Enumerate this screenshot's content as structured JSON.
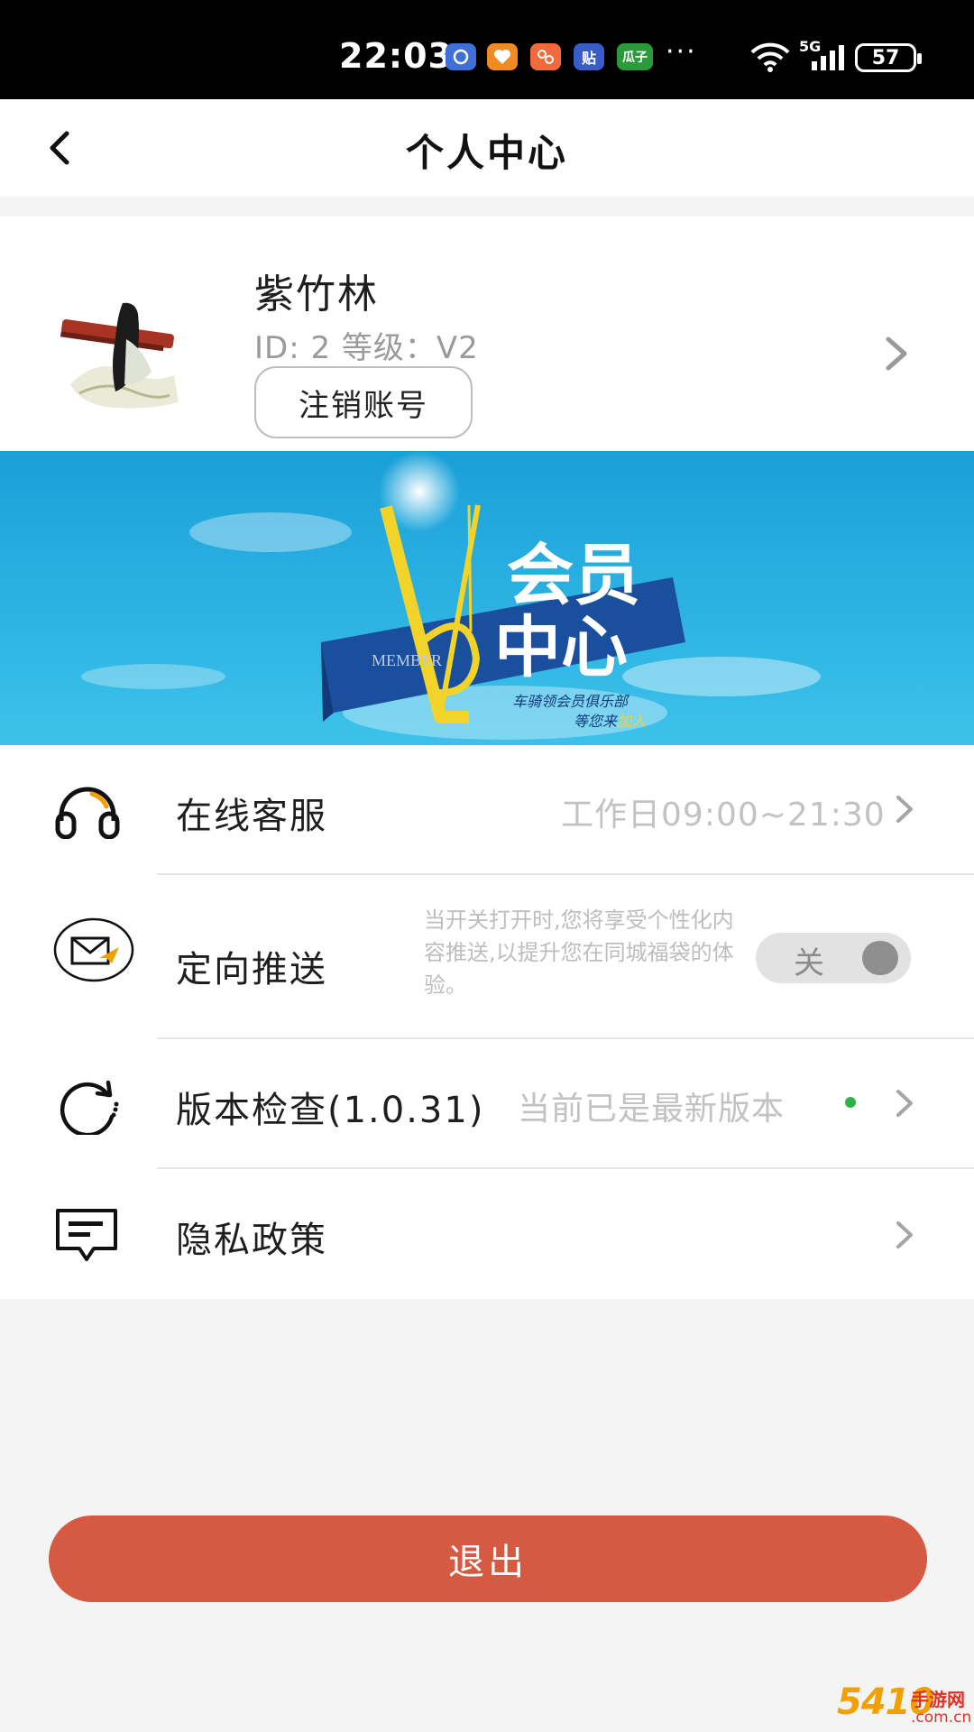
{
  "status_bar": {
    "time": "22:03",
    "apps": [
      {
        "icon": "phone-manager-icon",
        "text": "",
        "color": "#3f6fd8"
      },
      {
        "icon": "heart-app-icon",
        "text": "",
        "color": "#f08a24"
      },
      {
        "icon": "meituan-app-icon",
        "text": "",
        "color": "#f06a3c"
      },
      {
        "icon": "tieba-app-icon",
        "text": "贴",
        "color": "#3a5cc8"
      },
      {
        "icon": "guazi-app-icon",
        "text": "瓜子",
        "color": "#2a9a3a"
      }
    ],
    "more": "···",
    "network": "5G",
    "battery": "57"
  },
  "nav": {
    "title": "个人中心"
  },
  "profile": {
    "name": "紫竹林",
    "info": "ID: 2 等级：V2",
    "cancel_button": "注销账号"
  },
  "banner": {
    "title_line1": "会员",
    "title_line2": "中心",
    "letter": "V",
    "ribbon_text": "MEMBER",
    "caption1": "车骑领会员俱乐部",
    "caption2_prefix": "等您来",
    "caption2_highlight": "加入"
  },
  "menu": {
    "service": {
      "label": "在线客服",
      "value": "工作日09:00~21:30"
    },
    "push": {
      "label": "定向推送",
      "description": "当开关打开时,您将享受个性化内容推送,以提升您在同城福袋的体验。",
      "toggle_label": "关",
      "enabled": false
    },
    "version": {
      "label": "版本检查(1.0.31)",
      "value": "当前已是最新版本"
    },
    "privacy": {
      "label": "隐私政策"
    }
  },
  "logout": {
    "label": "退出"
  },
  "watermark": {
    "main": "5410",
    "sub": "手游网",
    "url": ".com.cn"
  },
  "colors": {
    "accent": "#d65a42",
    "status_dot": "#2fb344",
    "banner_sky": "#1aa6de",
    "banner_gold": "#f2d32a"
  }
}
